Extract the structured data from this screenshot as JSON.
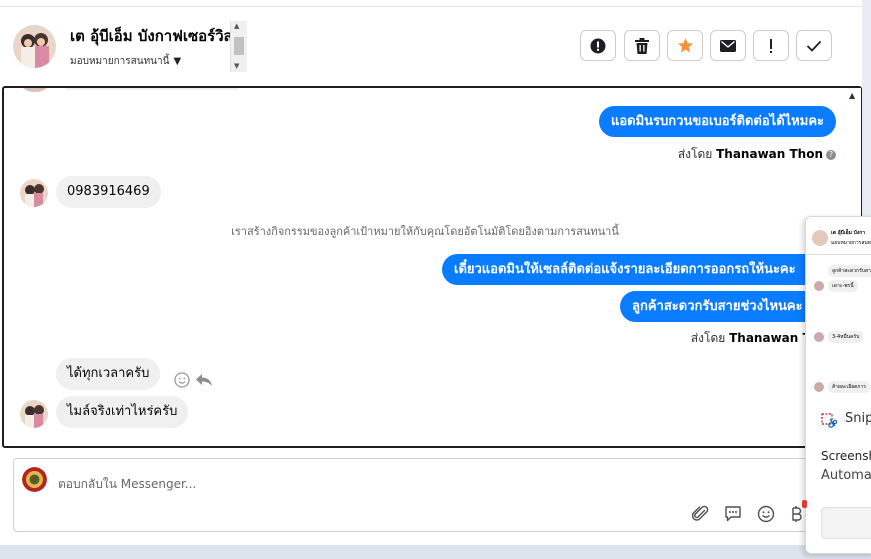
{
  "header": {
    "contact_name": "เต อุ้บีเอ็ม บังกาฟเซอร์วิส",
    "assign_label": "มอบหมายการสนทนานี้"
  },
  "actions": [
    {
      "name": "spam-button",
      "icon": "alert-circle-icon"
    },
    {
      "name": "delete-button",
      "icon": "trash-icon"
    },
    {
      "name": "star-button",
      "icon": "star-icon",
      "color": "#f7923b"
    },
    {
      "name": "mark-unread-button",
      "icon": "envelope-icon"
    },
    {
      "name": "important-button",
      "icon": "exclamation-icon"
    },
    {
      "name": "done-button",
      "icon": "check-icon"
    }
  ],
  "conversation": {
    "outgoing_1": "แอดมินรบกวนขอเบอร์ติดต่อได้ไหมคะ",
    "sent_by_1_prefix": "ส่งโดย",
    "sent_by_1_name": "Thanawan Thon",
    "incoming_phone": "0983916469",
    "system_note": "เราสร้างกิจกรรมของลูกค้าเป้าหมายให้กับคุณโดยอัตโนมัติโดยอิงตามการสนทนานี้",
    "outgoing_2": "เดี๋ยวแอดมินให้เซลล์ติดต่อแจ้งรายละเอียดการออกรถให้นะคะ",
    "outgoing_3": "ลูกค้าสะดวกรับสายช่วงไหนคะ",
    "sent_by_2_prefix": "ส่งโดย",
    "sent_by_2_name": "Thanawan Thon",
    "incoming_2": "ได้ทุกเวลาครับ",
    "incoming_3": "ไมล์จริงเท่าไหร่ครับ"
  },
  "composer": {
    "placeholder": "ตอบกลับใน Messenger..."
  },
  "overlay": {
    "thumb_name": "เต อุ้บีเอ็ม บังกา",
    "thumb_sub": "มอบหมายการสนทนานี้",
    "thumb_msgs": [
      "ลูกค้าสะดวกรับสายช่ว",
      "เดาะ-พรนี้",
      "3-4หมื่นครับ",
      "ส้ายละเอียดการ"
    ],
    "app_title": "Snipp",
    "label": "Screensh",
    "sub": "Automa"
  },
  "colors": {
    "accent": "#0a7cff",
    "star": "#f7923b"
  }
}
